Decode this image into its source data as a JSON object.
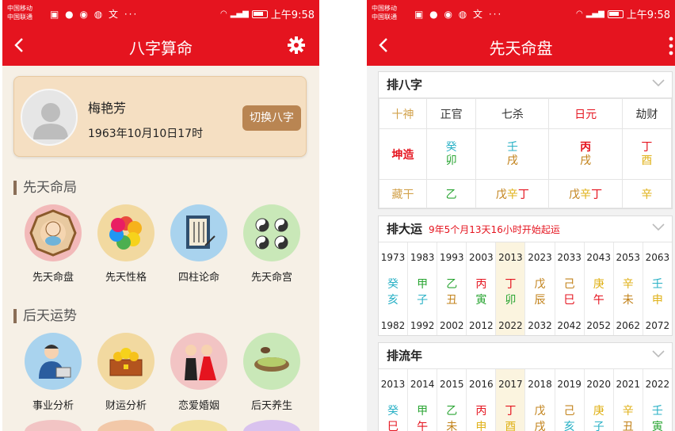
{
  "left": {
    "status": {
      "carrier1": "中国移动",
      "carrier2": "中国联通",
      "time": "上午9:58"
    },
    "title": "八字算命",
    "profile": {
      "name": "梅艳芳",
      "birth": "1963年10月10日17时",
      "switch_label": "切换八字"
    },
    "section1": "先天命局",
    "section2": "后天运势",
    "items1": [
      {
        "label": "先天命盘",
        "icon": "bagua-baby-icon",
        "bg": "#f2b9b9"
      },
      {
        "label": "先天性格",
        "icon": "color-petals-icon",
        "bg": "#f2d9a0"
      },
      {
        "label": "四柱论命",
        "icon": "scroll-book-icon",
        "bg": "#a9d3ee"
      },
      {
        "label": "先天命宫",
        "icon": "taiji-palace-icon",
        "bg": "#c9e8b8"
      }
    ],
    "items2": [
      {
        "label": "事业分析",
        "icon": "businessman-icon",
        "bg": "#a9d3ee"
      },
      {
        "label": "财运分析",
        "icon": "treasure-chest-icon",
        "bg": "#f2d9a0"
      },
      {
        "label": "恋爱婚姻",
        "icon": "wedding-couple-icon",
        "bg": "#f2c4c4"
      },
      {
        "label": "后天养生",
        "icon": "tea-bowl-icon",
        "bg": "#c9e8b8"
      }
    ]
  },
  "right": {
    "status": {
      "carrier1": "中国移动",
      "carrier2": "中国联通",
      "time": "上午9:58"
    },
    "title": "先天命盘",
    "bazi": {
      "title": "排八字",
      "shishen_label": "十神",
      "shishen": [
        "正官",
        "七杀",
        "日元",
        "劫财"
      ],
      "row_label": "坤造",
      "pillars": [
        {
          "top": "癸",
          "bottom": "卯"
        },
        {
          "top": "壬",
          "bottom": "戌"
        },
        {
          "top": "丙",
          "bottom": "戌"
        },
        {
          "top": "丁",
          "bottom": "酉"
        }
      ],
      "canggan_label": "藏干",
      "canggan": [
        [
          "乙"
        ],
        [
          "戊",
          "辛",
          "丁"
        ],
        [
          "戊",
          "辛",
          "丁"
        ],
        [
          "辛"
        ]
      ]
    },
    "dayun": {
      "title": "排大运",
      "subtitle": "9年5个月13天16小时开始起运",
      "cols": [
        {
          "start": "1973",
          "top": "癸",
          "bottom": "亥",
          "end": "1982"
        },
        {
          "start": "1983",
          "top": "甲",
          "bottom": "子",
          "end": "1992"
        },
        {
          "start": "1993",
          "top": "乙",
          "bottom": "丑",
          "end": "2002"
        },
        {
          "start": "2003",
          "top": "丙",
          "bottom": "寅",
          "end": "2012"
        },
        {
          "start": "2013",
          "top": "丁",
          "bottom": "卯",
          "end": "2022"
        },
        {
          "start": "2023",
          "top": "戊",
          "bottom": "辰",
          "end": "2032"
        },
        {
          "start": "2033",
          "top": "己",
          "bottom": "巳",
          "end": "2042"
        },
        {
          "start": "2043",
          "top": "庚",
          "bottom": "午",
          "end": "2052"
        },
        {
          "start": "2053",
          "top": "辛",
          "bottom": "未",
          "end": "2062"
        },
        {
          "start": "2063",
          "top": "壬",
          "bottom": "申",
          "end": "2072"
        }
      ]
    },
    "liunian": {
      "title": "排流年",
      "cols": [
        {
          "year": "2013",
          "top": "癸",
          "bottom": "巳"
        },
        {
          "year": "2014",
          "top": "甲",
          "bottom": "午"
        },
        {
          "year": "2015",
          "top": "乙",
          "bottom": "未"
        },
        {
          "year": "2016",
          "top": "丙",
          "bottom": "申"
        },
        {
          "year": "2017",
          "top": "丁",
          "bottom": "酉"
        },
        {
          "year": "2018",
          "top": "戊",
          "bottom": "戌"
        },
        {
          "year": "2019",
          "top": "己",
          "bottom": "亥"
        },
        {
          "year": "2020",
          "top": "庚",
          "bottom": "子"
        },
        {
          "year": "2021",
          "top": "辛",
          "bottom": "丑"
        },
        {
          "year": "2022",
          "top": "壬",
          "bottom": "寅"
        }
      ]
    }
  }
}
